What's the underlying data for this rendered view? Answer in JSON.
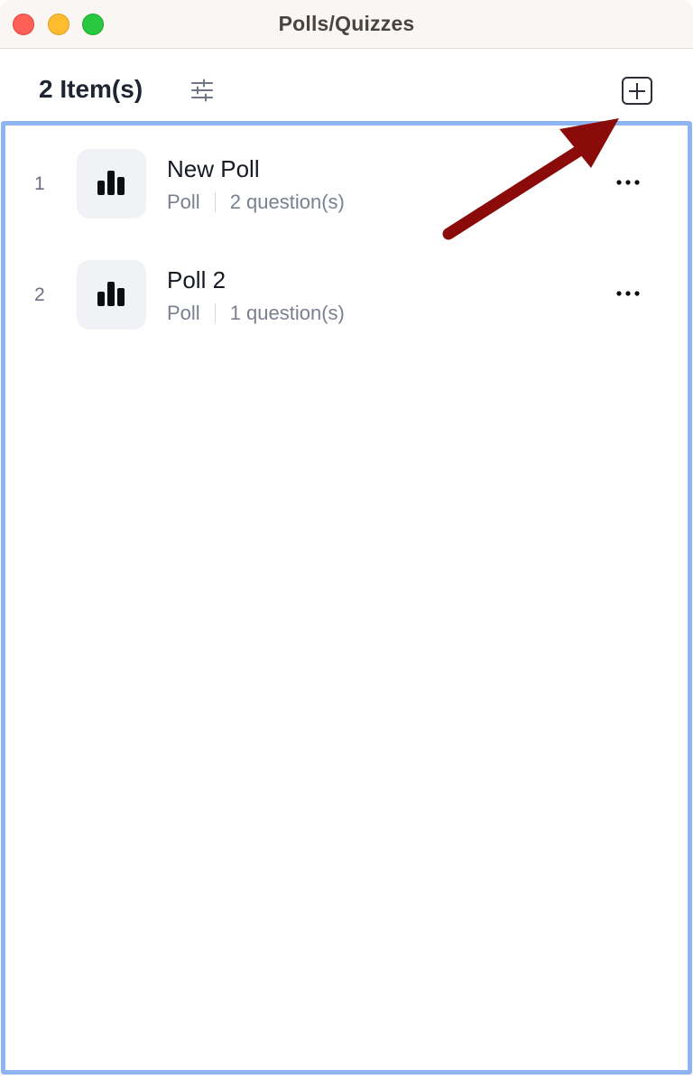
{
  "window": {
    "title": "Polls/Quizzes"
  },
  "toolbar": {
    "item_count": "2 Item(s)",
    "filter_icon": "sliders-icon",
    "add_icon": "plus-square-icon"
  },
  "items": [
    {
      "index": "1",
      "title": "New Poll",
      "type": "Poll",
      "questions": "2 question(s)",
      "icon": "bar-chart-icon"
    },
    {
      "index": "2",
      "title": "Poll 2",
      "type": "Poll",
      "questions": "1 question(s)",
      "icon": "bar-chart-icon"
    }
  ],
  "colors": {
    "panel_border": "#8fb4f2",
    "annotation_arrow": "#8b0a0a"
  }
}
